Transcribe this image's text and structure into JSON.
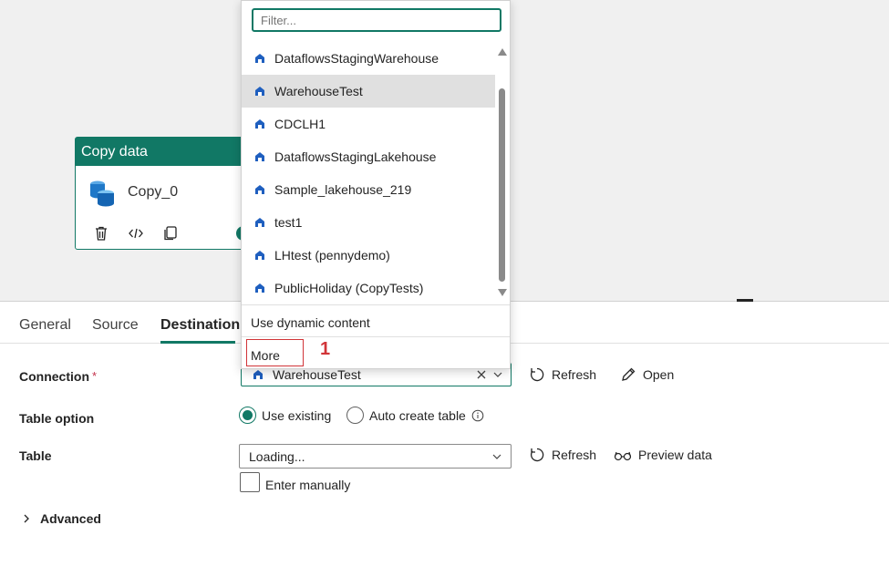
{
  "activity": {
    "header": "Copy data",
    "name": "Copy_0"
  },
  "tabs": [
    "General",
    "Source",
    "Destination"
  ],
  "form": {
    "connection_label": "Connection",
    "required_mark": "*",
    "connection_value": "WarehouseTest",
    "refresh_label": "Refresh",
    "open_label": "Open",
    "table_option_label": "Table option",
    "use_existing_label": "Use existing",
    "auto_create_label": "Auto create table",
    "table_label": "Table",
    "table_value": "Loading...",
    "refresh2_label": "Refresh",
    "preview_label": "Preview data",
    "enter_manually_label": "Enter manually",
    "advanced_label": "Advanced"
  },
  "dropdown": {
    "filter_placeholder": "Filter...",
    "items": [
      "DataflowsStagingWarehouse",
      "WarehouseTest",
      "CDCLH1",
      "DataflowsStagingLakehouse",
      "Sample_lakehouse_219",
      "test1",
      "LHtest (pennydemo)",
      "PublicHoliday (CopyTests)"
    ],
    "selected_item": "WarehouseTest",
    "dynamic_content": "Use dynamic content",
    "more": "More"
  },
  "annotation": "1",
  "colors": {
    "accent": "#117865",
    "annotation": "#d13438",
    "canvas": "#f0f0f0"
  }
}
